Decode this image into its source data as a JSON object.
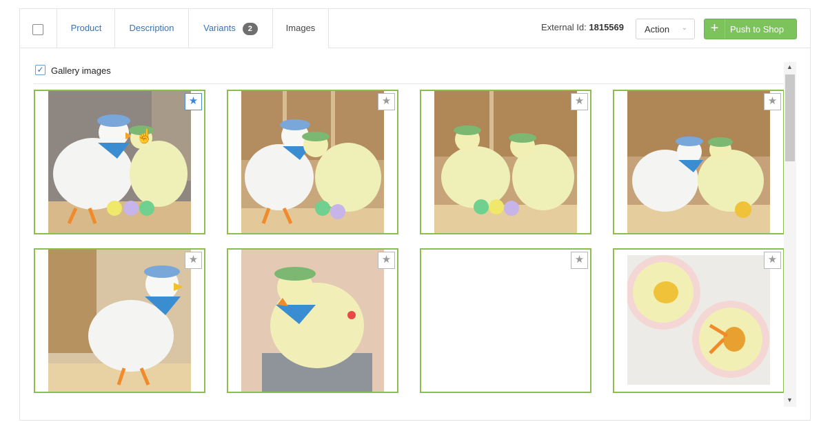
{
  "tabs": [
    {
      "label": "Product"
    },
    {
      "label": "Description"
    },
    {
      "label": "Variants",
      "badge": "2"
    },
    {
      "label": "Images"
    }
  ],
  "header": {
    "external_id_label": "External Id:",
    "external_id_value": "1815569",
    "action_label": "Action",
    "push_label": "Push to Shop"
  },
  "gallery": {
    "label": "Gallery images",
    "checked": true
  },
  "images": [
    {
      "name": "image-1",
      "primary": true,
      "has_image": true
    },
    {
      "name": "image-2",
      "primary": false,
      "has_image": true
    },
    {
      "name": "image-3",
      "primary": false,
      "has_image": true
    },
    {
      "name": "image-4",
      "primary": false,
      "has_image": true
    },
    {
      "name": "image-5",
      "primary": false,
      "has_image": true
    },
    {
      "name": "image-6",
      "primary": false,
      "has_image": true
    },
    {
      "name": "image-7",
      "primary": false,
      "has_image": false
    },
    {
      "name": "image-8",
      "primary": false,
      "has_image": true
    }
  ],
  "colors": {
    "accent_green": "#7cc35b",
    "tile_border": "#8cbe4f",
    "link_blue": "#3a73b0",
    "star_selected": "#3b86d6"
  },
  "icons": {
    "star": "star-icon",
    "plus": "plus-icon",
    "chevron": "chevron-down-icon",
    "check": "check-icon"
  }
}
